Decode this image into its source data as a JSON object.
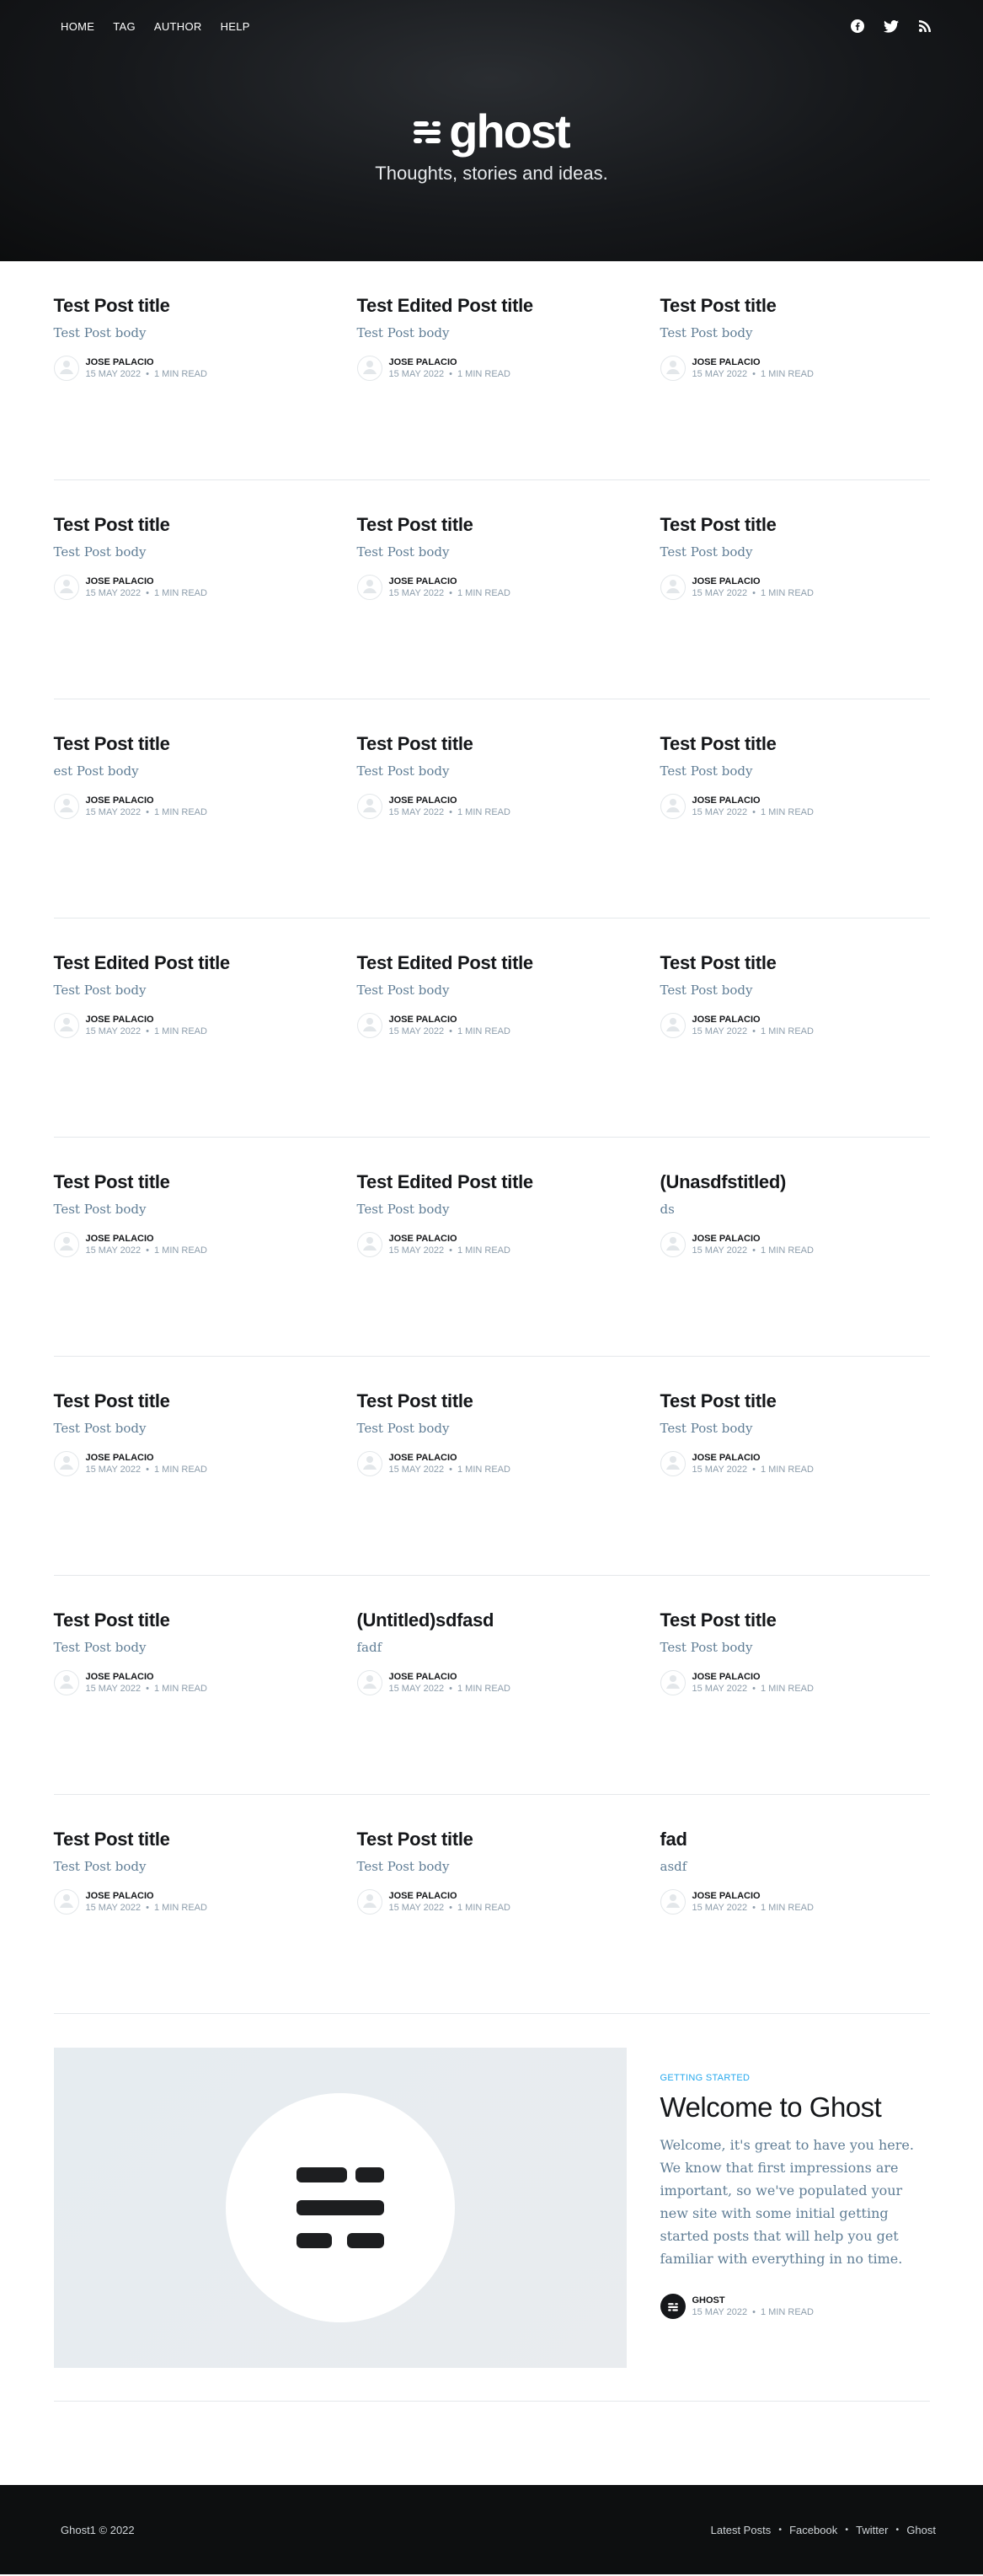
{
  "header": {
    "nav": [
      "HOME",
      "TAG",
      "AUTHOR",
      "HELP"
    ],
    "social_icons": [
      "facebook-icon",
      "twitter-icon",
      "rss-icon"
    ],
    "brand": "ghost",
    "tagline": "Thoughts, stories and ideas."
  },
  "post_rows": [
    [
      {
        "title": "Test Post title",
        "excerpt": "Test Post body",
        "author": "JOSE PALACIO",
        "date": "15 MAY 2022",
        "read": "1 MIN READ"
      },
      {
        "title": "Test Edited Post title",
        "excerpt": "Test Post body",
        "author": "JOSE PALACIO",
        "date": "15 MAY 2022",
        "read": "1 MIN READ"
      },
      {
        "title": "Test Post title",
        "excerpt": "Test Post body",
        "author": "JOSE PALACIO",
        "date": "15 MAY 2022",
        "read": "1 MIN READ"
      }
    ],
    [
      {
        "title": "Test Post title",
        "excerpt": "Test Post body",
        "author": "JOSE PALACIO",
        "date": "15 MAY 2022",
        "read": "1 MIN READ"
      },
      {
        "title": "Test Post title",
        "excerpt": "Test Post body",
        "author": "JOSE PALACIO",
        "date": "15 MAY 2022",
        "read": "1 MIN READ"
      },
      {
        "title": "Test Post title",
        "excerpt": "Test Post body",
        "author": "JOSE PALACIO",
        "date": "15 MAY 2022",
        "read": "1 MIN READ"
      }
    ],
    [
      {
        "title": "Test Post title",
        "excerpt": "est Post body",
        "author": "JOSE PALACIO",
        "date": "15 MAY 2022",
        "read": "1 MIN READ"
      },
      {
        "title": "Test Post title",
        "excerpt": "Test Post body",
        "author": "JOSE PALACIO",
        "date": "15 MAY 2022",
        "read": "1 MIN READ"
      },
      {
        "title": "Test Post title",
        "excerpt": "Test Post body",
        "author": "JOSE PALACIO",
        "date": "15 MAY 2022",
        "read": "1 MIN READ"
      }
    ],
    [
      {
        "title": "Test Edited Post title",
        "excerpt": "Test Post body",
        "author": "JOSE PALACIO",
        "date": "15 MAY 2022",
        "read": "1 MIN READ"
      },
      {
        "title": "Test Edited Post title",
        "excerpt": "Test Post body",
        "author": "JOSE PALACIO",
        "date": "15 MAY 2022",
        "read": "1 MIN READ"
      },
      {
        "title": "Test Post title",
        "excerpt": "Test Post body",
        "author": "JOSE PALACIO",
        "date": "15 MAY 2022",
        "read": "1 MIN READ"
      }
    ],
    [
      {
        "title": "Test Post title",
        "excerpt": "Test Post body",
        "author": "JOSE PALACIO",
        "date": "15 MAY 2022",
        "read": "1 MIN READ"
      },
      {
        "title": "Test Edited Post title",
        "excerpt": "Test Post body",
        "author": "JOSE PALACIO",
        "date": "15 MAY 2022",
        "read": "1 MIN READ"
      },
      {
        "title": "(Unasdfstitled)",
        "excerpt": "ds",
        "author": "JOSE PALACIO",
        "date": "15 MAY 2022",
        "read": "1 MIN READ"
      }
    ],
    [
      {
        "title": "Test Post title",
        "excerpt": "Test Post body",
        "author": "JOSE PALACIO",
        "date": "15 MAY 2022",
        "read": "1 MIN READ"
      },
      {
        "title": "Test Post title",
        "excerpt": "Test Post body",
        "author": "JOSE PALACIO",
        "date": "15 MAY 2022",
        "read": "1 MIN READ"
      },
      {
        "title": "Test Post title",
        "excerpt": "Test Post body",
        "author": "JOSE PALACIO",
        "date": "15 MAY 2022",
        "read": "1 MIN READ"
      }
    ],
    [
      {
        "title": "Test Post title",
        "excerpt": "Test Post body",
        "author": "JOSE PALACIO",
        "date": "15 MAY 2022",
        "read": "1 MIN READ"
      },
      {
        "title": "(Untitled)sdfasd",
        "excerpt": "fadf",
        "author": "JOSE PALACIO",
        "date": "15 MAY 2022",
        "read": "1 MIN READ"
      },
      {
        "title": "Test Post title",
        "excerpt": "Test Post body",
        "author": "JOSE PALACIO",
        "date": "15 MAY 2022",
        "read": "1 MIN READ"
      }
    ],
    [
      {
        "title": "Test Post title",
        "excerpt": "Test Post body",
        "author": "JOSE PALACIO",
        "date": "15 MAY 2022",
        "read": "1 MIN READ"
      },
      {
        "title": "Test Post title",
        "excerpt": "Test Post body",
        "author": "JOSE PALACIO",
        "date": "15 MAY 2022",
        "read": "1 MIN READ"
      },
      {
        "title": "fad",
        "excerpt": "asdf",
        "author": "JOSE PALACIO",
        "date": "15 MAY 2022",
        "read": "1 MIN READ"
      }
    ]
  ],
  "featured": {
    "tag": "GETTING STARTED",
    "title": "Welcome to Ghost",
    "excerpt": "Welcome, it's great to have you here. We know that first impressions are important, so we've populated your new site with some initial getting started posts that will help you get familiar with everything in no time.",
    "author": "GHOST",
    "date": "15 MAY 2022",
    "read": "1 MIN READ"
  },
  "footer": {
    "copyright": "Ghost1 © 2022",
    "links": [
      "Latest Posts",
      "Facebook",
      "Twitter",
      "Ghost"
    ]
  },
  "colors": {
    "header_bg": "#16181b",
    "excerpt": "#5f7d95",
    "tag_accent": "#26a8ed",
    "footer_bg": "#0d0f10"
  }
}
